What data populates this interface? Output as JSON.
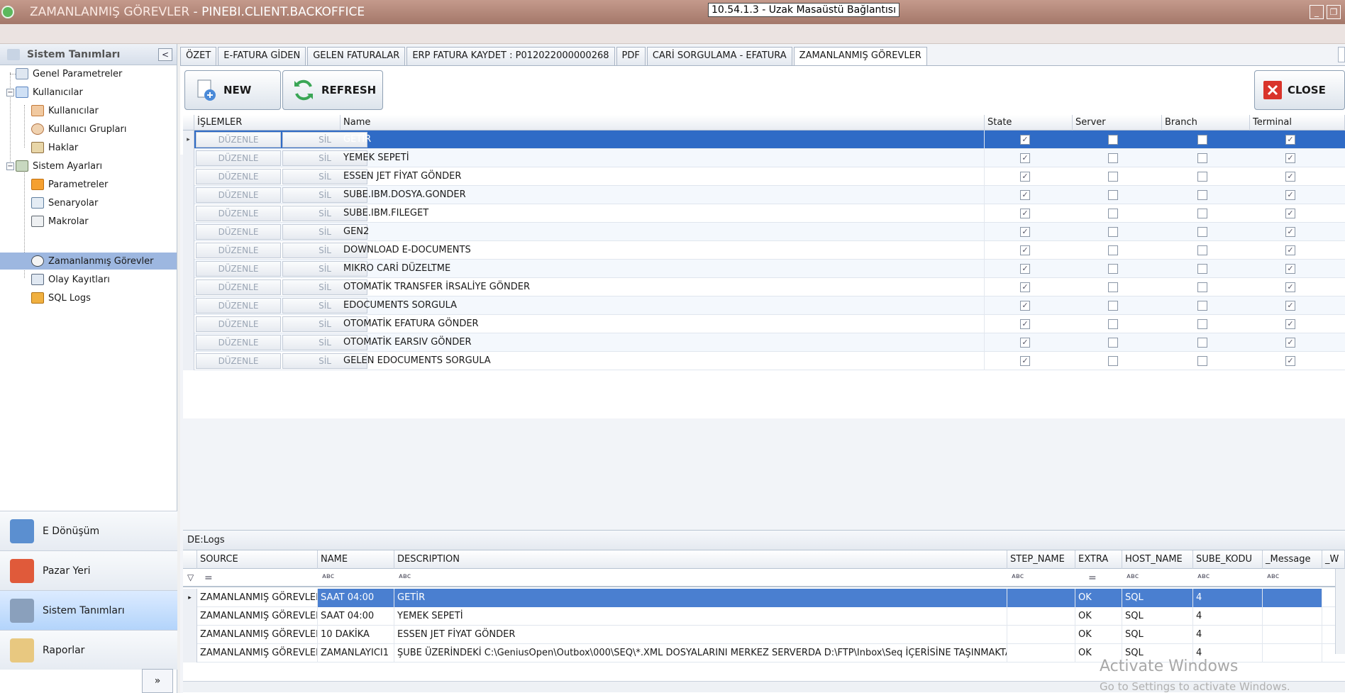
{
  "window": {
    "title_prefix": "ZAMANLANMIŞ GÖREVLER",
    "title_app": " - PINEBI.CLIENT.BACKOFFICE",
    "rdp_label": "10.54.1.3 - Uzak Masaüstü Bağlantısı",
    "min_glyph": "_",
    "restore_glyph": "❐"
  },
  "sidebar": {
    "title": "Sistem Tanımları",
    "collapse_glyph": "<",
    "items": [
      {
        "label": "Genel Parametreler"
      },
      {
        "label": "Kullanıcılar"
      },
      {
        "label": "Kullanıcılar"
      },
      {
        "label": "Kullanıcı Grupları"
      },
      {
        "label": "Haklar"
      },
      {
        "label": "Sistem Ayarları"
      },
      {
        "label": "Parametreler"
      },
      {
        "label": "Senaryolar"
      },
      {
        "label": "Makrolar"
      },
      {
        "label": "Zamanlanmış Görevler"
      },
      {
        "label": "Olay Kayıtları"
      },
      {
        "label": "SQL Logs"
      }
    ],
    "bottom": [
      {
        "label": "E Dönüşüm"
      },
      {
        "label": "Pazar Yeri"
      },
      {
        "label": "Sistem Tanımları"
      },
      {
        "label": "Raporlar"
      }
    ],
    "expand_glyph": "»"
  },
  "tabs": [
    {
      "label": "ÖZET"
    },
    {
      "label": "E-FATURA GİDEN"
    },
    {
      "label": "GELEN FATURALAR"
    },
    {
      "label": "ERP FATURA KAYDET : P012022000000268"
    },
    {
      "label": "PDF"
    },
    {
      "label": "CARİ SORGULAMA - EFATURA"
    },
    {
      "label": "ZAMANLANMIŞ GÖREVLER"
    }
  ],
  "toolbar": {
    "new_label": "NEW",
    "refresh_label": "REFRESH",
    "close_label": "CLOSE"
  },
  "grid": {
    "columns": {
      "islemler": "İŞLEMLER",
      "name": "Name",
      "state": "State",
      "server": "Server",
      "branch": "Branch",
      "terminal": "Terminal"
    },
    "edit_label": "DÜZENLE",
    "delete_label": "SİL",
    "check_glyph": "✓",
    "row_indicator": "▸",
    "rows": [
      {
        "name": "GETİR",
        "state": true,
        "server": false,
        "branch": false,
        "terminal": true
      },
      {
        "name": "YEMEK SEPETİ",
        "state": true,
        "server": false,
        "branch": false,
        "terminal": true
      },
      {
        "name": "ESSEN JET FİYAT GÖNDER",
        "state": true,
        "server": false,
        "branch": false,
        "terminal": true
      },
      {
        "name": "SUBE.IBM.DOSYA.GONDER",
        "state": true,
        "server": false,
        "branch": false,
        "terminal": true
      },
      {
        "name": "SUBE.IBM.FILEGET",
        "state": true,
        "server": false,
        "branch": false,
        "terminal": true
      },
      {
        "name": "GEN2",
        "state": true,
        "server": false,
        "branch": false,
        "terminal": true
      },
      {
        "name": "DOWNLOAD E-DOCUMENTS",
        "state": true,
        "server": false,
        "branch": false,
        "terminal": true
      },
      {
        "name": "MIKRO CARİ DÜZELTME",
        "state": true,
        "server": false,
        "branch": false,
        "terminal": true
      },
      {
        "name": "OTOMATİK TRANSFER İRSALİYE GÖNDER",
        "state": true,
        "server": false,
        "branch": false,
        "terminal": true
      },
      {
        "name": "EDOCUMENTS SORGULA",
        "state": true,
        "server": false,
        "branch": false,
        "terminal": true
      },
      {
        "name": "OTOMATİK EFATURA GÖNDER",
        "state": true,
        "server": false,
        "branch": false,
        "terminal": true
      },
      {
        "name": "OTOMATİK EARSIV GÖNDER",
        "state": true,
        "server": false,
        "branch": false,
        "terminal": true
      },
      {
        "name": "GELEN EDOCUMENTS SORGULA",
        "state": true,
        "server": false,
        "branch": false,
        "terminal": true
      }
    ]
  },
  "logs": {
    "title": "DE:Logs",
    "columns": {
      "source": "SOURCE",
      "name": "NAME",
      "description": "DESCRIPTION",
      "step_name": "STEP_NAME",
      "extra": "EXTRA",
      "host_name": "HOST_NAME",
      "sube_kodu": "SUBE_KODU",
      "message": "_Message",
      "w": "_W"
    },
    "filter_eq": "=",
    "filter_abc": "ᴀʙc",
    "filter_funnel": "▽",
    "rows": [
      {
        "source": "ZAMANLANMIŞ GÖREVLER",
        "name": "SAAT 04:00",
        "description": "GETİR",
        "extra": "OK",
        "host": "SQL",
        "sube": "4"
      },
      {
        "source": "ZAMANLANMIŞ GÖREVLER",
        "name": "SAAT 04:00",
        "description": "YEMEK SEPETİ",
        "extra": "OK",
        "host": "SQL",
        "sube": "4"
      },
      {
        "source": "ZAMANLANMIŞ GÖREVLER",
        "name": "10 DAKİKA",
        "description": "ESSEN JET FİYAT GÖNDER",
        "extra": "OK",
        "host": "SQL",
        "sube": "4"
      },
      {
        "source": "ZAMANLANMIŞ GÖREVLER",
        "name": "ZAMANLAYICI1",
        "description": "ŞUBE ÜZERİNDEKİ C:\\GeniusOpen\\Outbox\\000\\SEQ\\*.XML DOSYALARINI MERKEZ SERVERDA D:\\FTP\\Inbox\\Seq İÇERİSİNE TAŞINMAKTADIR.",
        "extra": "OK",
        "host": "SQL",
        "sube": "4"
      }
    ]
  },
  "watermark": {
    "line1": "Activate Windows",
    "line2": "Go to Settings to activate Windows."
  },
  "colors": {
    "titlebar": "#a4786a",
    "selection": "#2f6bc6",
    "close_red": "#d9342b",
    "refresh_green": "#3aa655"
  }
}
